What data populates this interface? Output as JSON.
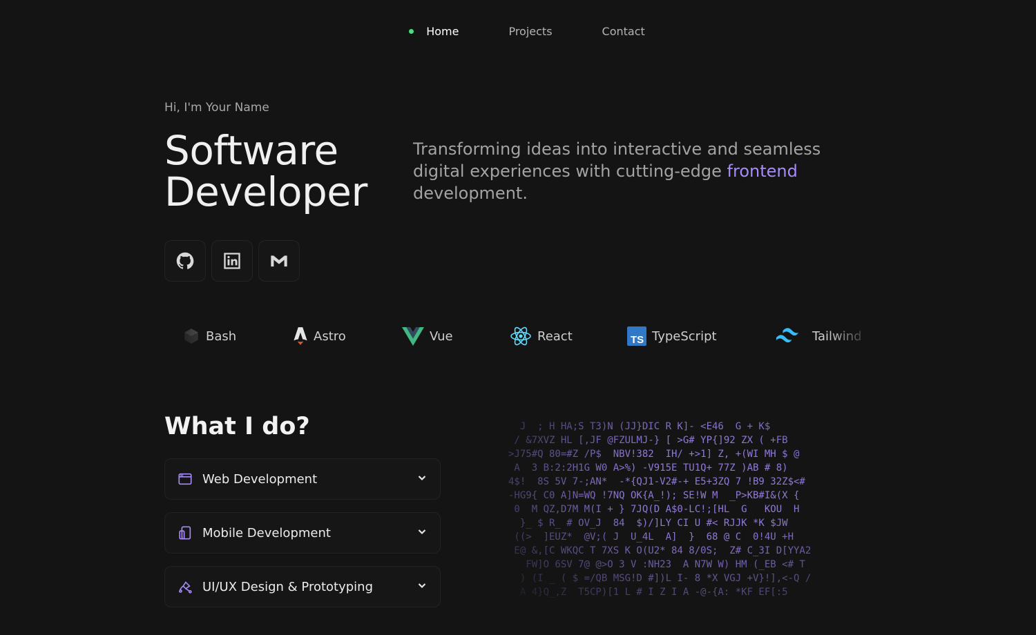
{
  "nav": {
    "items": [
      {
        "label": "Home",
        "active": true
      },
      {
        "label": "Projects",
        "active": false
      },
      {
        "label": "Contact",
        "active": false
      }
    ],
    "active_dot_color": "#4ade80"
  },
  "hero": {
    "greeting": "Hi, I'm Your Name",
    "role_line1": "Software",
    "role_line2": "Developer",
    "tagline_before": "Transforming ideas into interactive and seamless digital experiences with cutting-edge ",
    "tagline_accent": "frontend",
    "tagline_after": " development.",
    "accent_color": "#a78bfa"
  },
  "socials": [
    {
      "name": "github",
      "icon": "github-icon"
    },
    {
      "name": "linkedin",
      "icon": "linkedin-icon"
    },
    {
      "name": "gmail",
      "icon": "gmail-icon"
    }
  ],
  "tech": [
    {
      "label": "Bash",
      "icon": "bash-icon"
    },
    {
      "label": "Astro",
      "icon": "astro-icon"
    },
    {
      "label": "Vue",
      "icon": "vue-icon"
    },
    {
      "label": "React",
      "icon": "react-icon"
    },
    {
      "label": "TypeScript",
      "icon": "typescript-icon"
    },
    {
      "label": "Tailwind",
      "icon": "tailwind-icon"
    }
  ],
  "what_i_do": {
    "title": "What I do?",
    "items": [
      {
        "label": "Web Development",
        "icon": "browser-window-icon"
      },
      {
        "label": "Mobile Development",
        "icon": "mobile-device-icon"
      },
      {
        "label": "UI/UX Design & Prototyping",
        "icon": "design-pen-icon"
      }
    ]
  },
  "matrix_lines": [
    "  J  ; H HA;S T3)N (JJ}DIC R K]- <E46  G + K$",
    " / &7XVZ HL [,JF @FZULMJ-} [ >G# YP{]92 ZX ( +FB",
    ">J75#Q 80=#Z /P$  NBV!382  IH/ +>1] Z, +(WI MH $ @",
    " A  3 B:2:2H1G W0 A>%) -V915E TU1Q+ 77Z )AB # 8)",
    "4$!  8S 5V 7-;AN*  -*{QJ1-V2#-+ E5+3ZQ 7 !B9 32Z$<#",
    "-HG9{ C0 A]N=WQ !7NQ OK{A_!); SE!W M  _P>KB#I&(X {",
    " 0  M QZ,D7M M(I + } 7JQ(D A$0-LC!;[HL  G   KOU  H",
    "  }_ $ R_ # OV_J  84  $)/]LY CI U #< RJJK *K $JW",
    " ((>  ]EUZ*  @V;( J  U_4L  A]  }  68 @ C  0!4U +H",
    " E@ &,[C WKQC T 7XS K O(U2* 84 8/0S;  Z# C_3I D[YYA2",
    "   FW]O 6SV 7@ @>O 3 V :NH23  A N7W W) HM (_EB <# T",
    "  ) (I _ ( $ =/QB MSG!D #])L I- 8 *X VGJ +V}!],<-Q /",
    "  A 4}Q_,Z  T5CP)[1 L # I Z I A -@-{A: *KF EF[:5 "
  ]
}
